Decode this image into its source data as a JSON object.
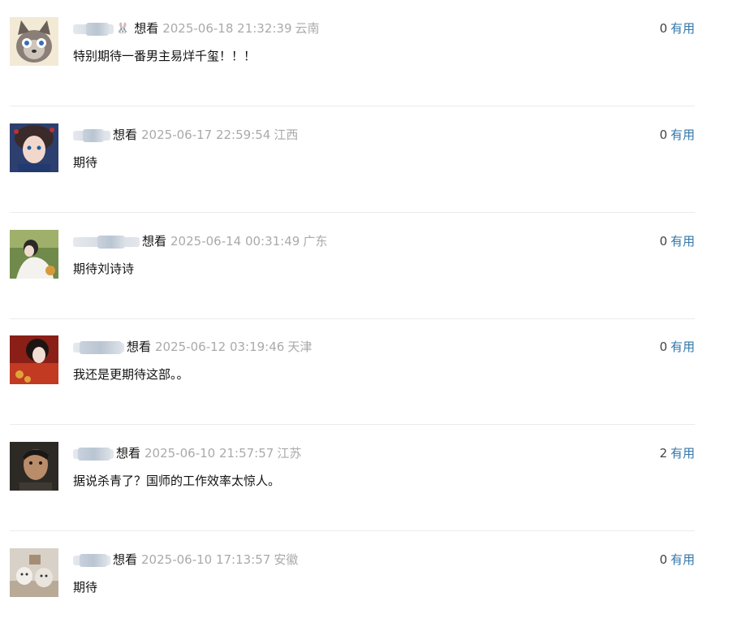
{
  "comments": [
    {
      "status": "想看",
      "time": "2025-06-18 21:32:39",
      "region": "云南",
      "votes": "0",
      "useful_label": "有用",
      "text": "特别期待一番男主易烊千玺！！！",
      "badge": "🐰",
      "avatar_icon": "cat-avatar"
    },
    {
      "status": "想看",
      "time": "2025-06-17 22:59:54",
      "region": "江西",
      "votes": "0",
      "useful_label": "有用",
      "text": "期待",
      "avatar_icon": "anime-avatar"
    },
    {
      "status": "想看",
      "time": "2025-06-14 00:31:49",
      "region": "广东",
      "votes": "0",
      "useful_label": "有用",
      "text": "期待刘诗诗",
      "avatar_icon": "photo-avatar"
    },
    {
      "status": "想看",
      "time": "2025-06-12 03:19:46",
      "region": "天津",
      "votes": "0",
      "useful_label": "有用",
      "text": "我还是更期待这部。。",
      "avatar_icon": "portrait-avatar"
    },
    {
      "status": "想看",
      "time": "2025-06-10 21:57:57",
      "region": "江苏",
      "votes": "2",
      "useful_label": "有用",
      "text": "据说杀青了？国师的工作效率太惊人。",
      "avatar_icon": "man-avatar"
    },
    {
      "status": "想看",
      "time": "2025-06-10 17:13:57",
      "region": "安徽",
      "votes": "0",
      "useful_label": "有用",
      "text": "期待",
      "avatar_icon": "cats-avatar"
    }
  ]
}
